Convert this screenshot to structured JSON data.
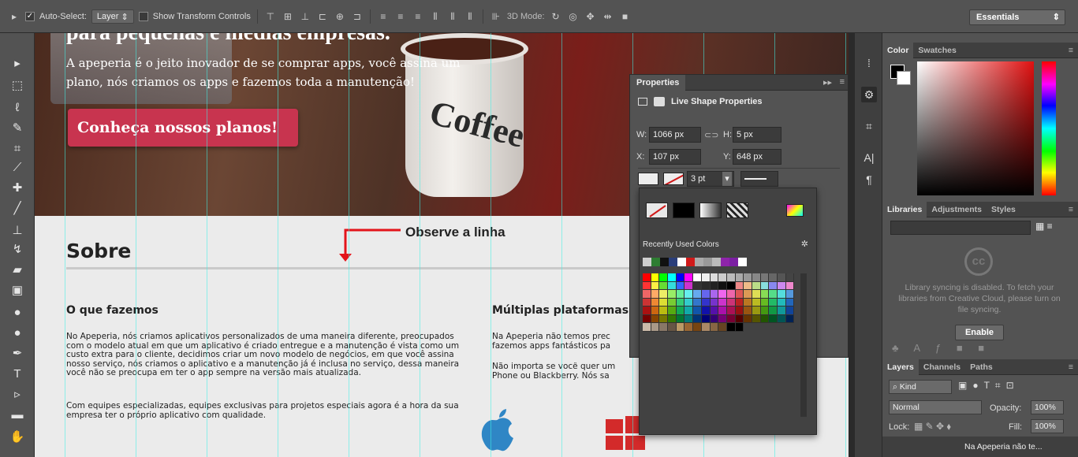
{
  "toolbar": {
    "auto_select_label": "Auto-Select:",
    "auto_select_value": "Layer",
    "show_transform_label": "Show Transform Controls",
    "mode3d_label": "3D Mode:",
    "workspace": "Essentials"
  },
  "page": {
    "headline": "para pequenas e médias empresas.",
    "subtitle": "A apeperia é o jeito inovador de se comprar apps, você assina um plano, nós criamos os apps e fazemos toda a manutenção!",
    "cta": "Conheça nossos planos!",
    "mug_text": "Coffee",
    "section_title": "Sobre",
    "annotation": "Observe a linha",
    "col1_title": "O que fazemos",
    "col1_p1": "No Apeperia, nós criamos aplicativos personalizados de uma maneira diferente, preocupados com o modelo atual em que um aplicativo é criado entregue e a manutenção é vista como um custo extra para o cliente, decidimos criar um novo modelo de negócios, em que você assina nosso serviço, nós criamos o aplicativo e a manutenção já é inclusa no serviço, dessa maneira você não se preocupa em ter o app sempre na versão mais atualizada.",
    "col1_p2": "Com equipes especializadas, equipes exclusivas para projetos especiais agora é a hora da sua empresa ter o próprio aplicativo com qualidade.",
    "col2_title": "Múltiplas plataformas",
    "col2_p1": "Na Apeperia não temos prec fazemos apps fantásticos pa",
    "col2_p2": "Não importa se você quer um Phone ou Blackberry. Nós sa"
  },
  "properties": {
    "tab": "Properties",
    "header": "Live Shape Properties",
    "w_label": "W:",
    "w": "1066 px",
    "h_label": "H:",
    "h": "5 px",
    "x_label": "X:",
    "x": "107 px",
    "y_label": "Y:",
    "y": "648 px",
    "stroke_width": "3 pt"
  },
  "picker": {
    "recent_label": "Recently Used Colors"
  },
  "color_panel": {
    "tabs": [
      "Color",
      "Swatches"
    ],
    "fg": "#000000",
    "bg": "#ffffff"
  },
  "libraries": {
    "tabs": [
      "Libraries",
      "Adjustments",
      "Styles"
    ],
    "message": "Library syncing is disabled. To fetch your libraries from Creative Cloud, please turn on file syncing.",
    "enable": "Enable"
  },
  "layers": {
    "tabs": [
      "Layers",
      "Channels",
      "Paths"
    ],
    "kind": "Kind",
    "blend": "Normal",
    "opacity_label": "Opacity:",
    "opacity": "100%",
    "lock_label": "Lock:",
    "fill_label": "Fill:",
    "fill": "100%",
    "layer_name": "Na Apeperia não te..."
  }
}
